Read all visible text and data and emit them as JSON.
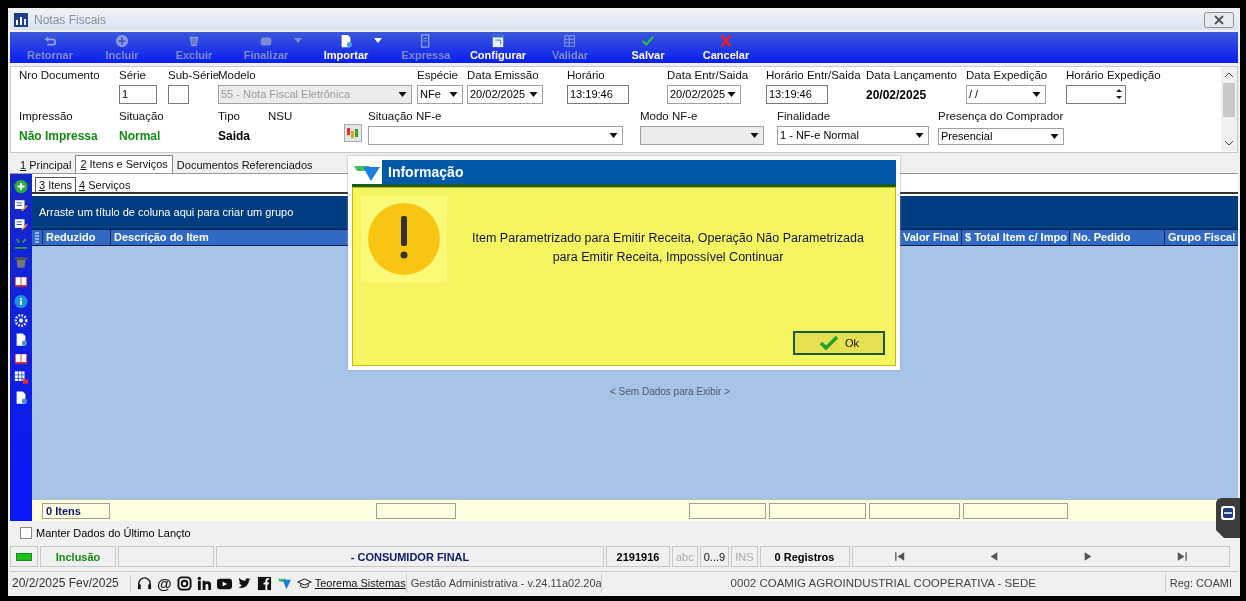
{
  "window": {
    "title": "Notas Fiscais"
  },
  "toolbar": [
    {
      "label": "Retornar",
      "disabled": true,
      "dropdown": false
    },
    {
      "label": "Incluir",
      "disabled": true,
      "dropdown": false
    },
    {
      "label": "Excluir",
      "disabled": true,
      "dropdown": false
    },
    {
      "label": "Finalizar",
      "disabled": true,
      "dropdown": true
    },
    {
      "label": "Importar",
      "disabled": false,
      "dropdown": true
    },
    {
      "label": "Expressa",
      "disabled": true,
      "dropdown": false
    },
    {
      "label": "Configurar",
      "disabled": false,
      "dropdown": false
    },
    {
      "label": "Validar",
      "disabled": true,
      "dropdown": false
    },
    {
      "label": "Salvar",
      "disabled": false,
      "dropdown": false
    },
    {
      "label": "Cancelar",
      "disabled": false,
      "dropdown": false
    }
  ],
  "form": {
    "top_fields": [
      {
        "label": "Nro Documento",
        "kind": "label"
      },
      {
        "label": "Série",
        "kind": "input",
        "value": "1"
      },
      {
        "label": "Sub-Série",
        "kind": "input"
      },
      {
        "label": "Modelo",
        "kind": "select",
        "value": "55 - Nota Fiscal Eletrônica",
        "disabled": true
      },
      {
        "label": "Espécie",
        "kind": "select",
        "value": "NFe",
        "disabled": false
      },
      {
        "label": "Data Emissão",
        "kind": "select",
        "value": "20/02/2025",
        "disabled": false
      },
      {
        "label": "Horário",
        "kind": "input",
        "value": "13:19:46"
      },
      {
        "label": "Data Entr/Saida",
        "kind": "select",
        "value": "20/02/2025",
        "disabled": false
      },
      {
        "label": "Horário Entr/Saida",
        "kind": "input",
        "value": "13:19:46"
      },
      {
        "label": "Data Lançamento",
        "kind": "text",
        "value": "20/02/2025",
        "color": "#000000"
      },
      {
        "label": "Data Expedição",
        "kind": "select",
        "value": " /  /",
        "disabled": false
      },
      {
        "label": "Horário Expedição",
        "kind": "spinner"
      }
    ],
    "bottom_fields": [
      {
        "label": "Impressão",
        "kind": "text",
        "value": "Não Impressa",
        "color": "#138a13"
      },
      {
        "label": "Situação",
        "kind": "text",
        "value": "Normal",
        "color": "#138a13"
      },
      {
        "label": "Tipo",
        "kind": "text",
        "value": "Saida",
        "color": "#000000"
      },
      {
        "label": "NSU",
        "kind": "label"
      },
      {
        "kind": "icon-button"
      },
      {
        "label": "Situação NF-e",
        "kind": "select",
        "disabled": false
      },
      {
        "label": "Modo NF-e",
        "kind": "select",
        "disabled": true
      },
      {
        "label": "Finalidade",
        "kind": "select",
        "value": "1 - NF-e Normal",
        "disabled": false
      },
      {
        "label": "Presença do Comprador",
        "kind": "select",
        "value": "Presencial",
        "disabled": false
      }
    ]
  },
  "tabs": [
    {
      "key": "1",
      "label": " Principal",
      "selected": false
    },
    {
      "key": "2",
      "label": " Itens e Serviços",
      "selected": true
    },
    {
      "label": "Documentos Referenciados",
      "selected": false
    }
  ],
  "subtabs": [
    {
      "key": "3",
      "label": " Itens",
      "selected": true
    },
    {
      "key": "4",
      "label": " Serviços",
      "selected": false
    }
  ],
  "grid": {
    "group_hint": "Arraste um título de coluna aqui para criar um grupo",
    "columns_left": [
      "Reduzido",
      "Descrição do Item"
    ],
    "columns_right": [
      "Valor Final",
      "$ Total Item c/ Impo",
      "No. Pedido",
      "Grupo Fiscal"
    ],
    "empty_text": "< Sem Dados para Exibir >",
    "footer_count": "0 Itens"
  },
  "keep_last": {
    "label": "Manter Dados do Último Lançto",
    "checked": false
  },
  "status_bar": {
    "mode": "Inclusão",
    "customer": "- CONSUMIDOR FINAL",
    "code": "2191916",
    "indicators": [
      {
        "label": "abc",
        "on": false
      },
      {
        "label": "0...9",
        "on": true
      },
      {
        "label": "INS",
        "on": false
      }
    ],
    "records": "0 Registros"
  },
  "bottom_bar": {
    "date": "20/2/2025 Fev/2025",
    "at_glyph": "@",
    "link": "Teorema Sistemas",
    "app": "Gestão Administrativa - v.24.11a02.20a",
    "company": "0002 COAMIG AGROINDUSTRIAL COOPERATIVA - SEDE",
    "reg": "Reg: COAMI"
  },
  "dialog": {
    "title": "Informação",
    "message": "Item Parametrizado para Emitir Receita, Operação Não Parametrizada para Emitir Receita, Impossível Continuar",
    "button": "Ok"
  }
}
